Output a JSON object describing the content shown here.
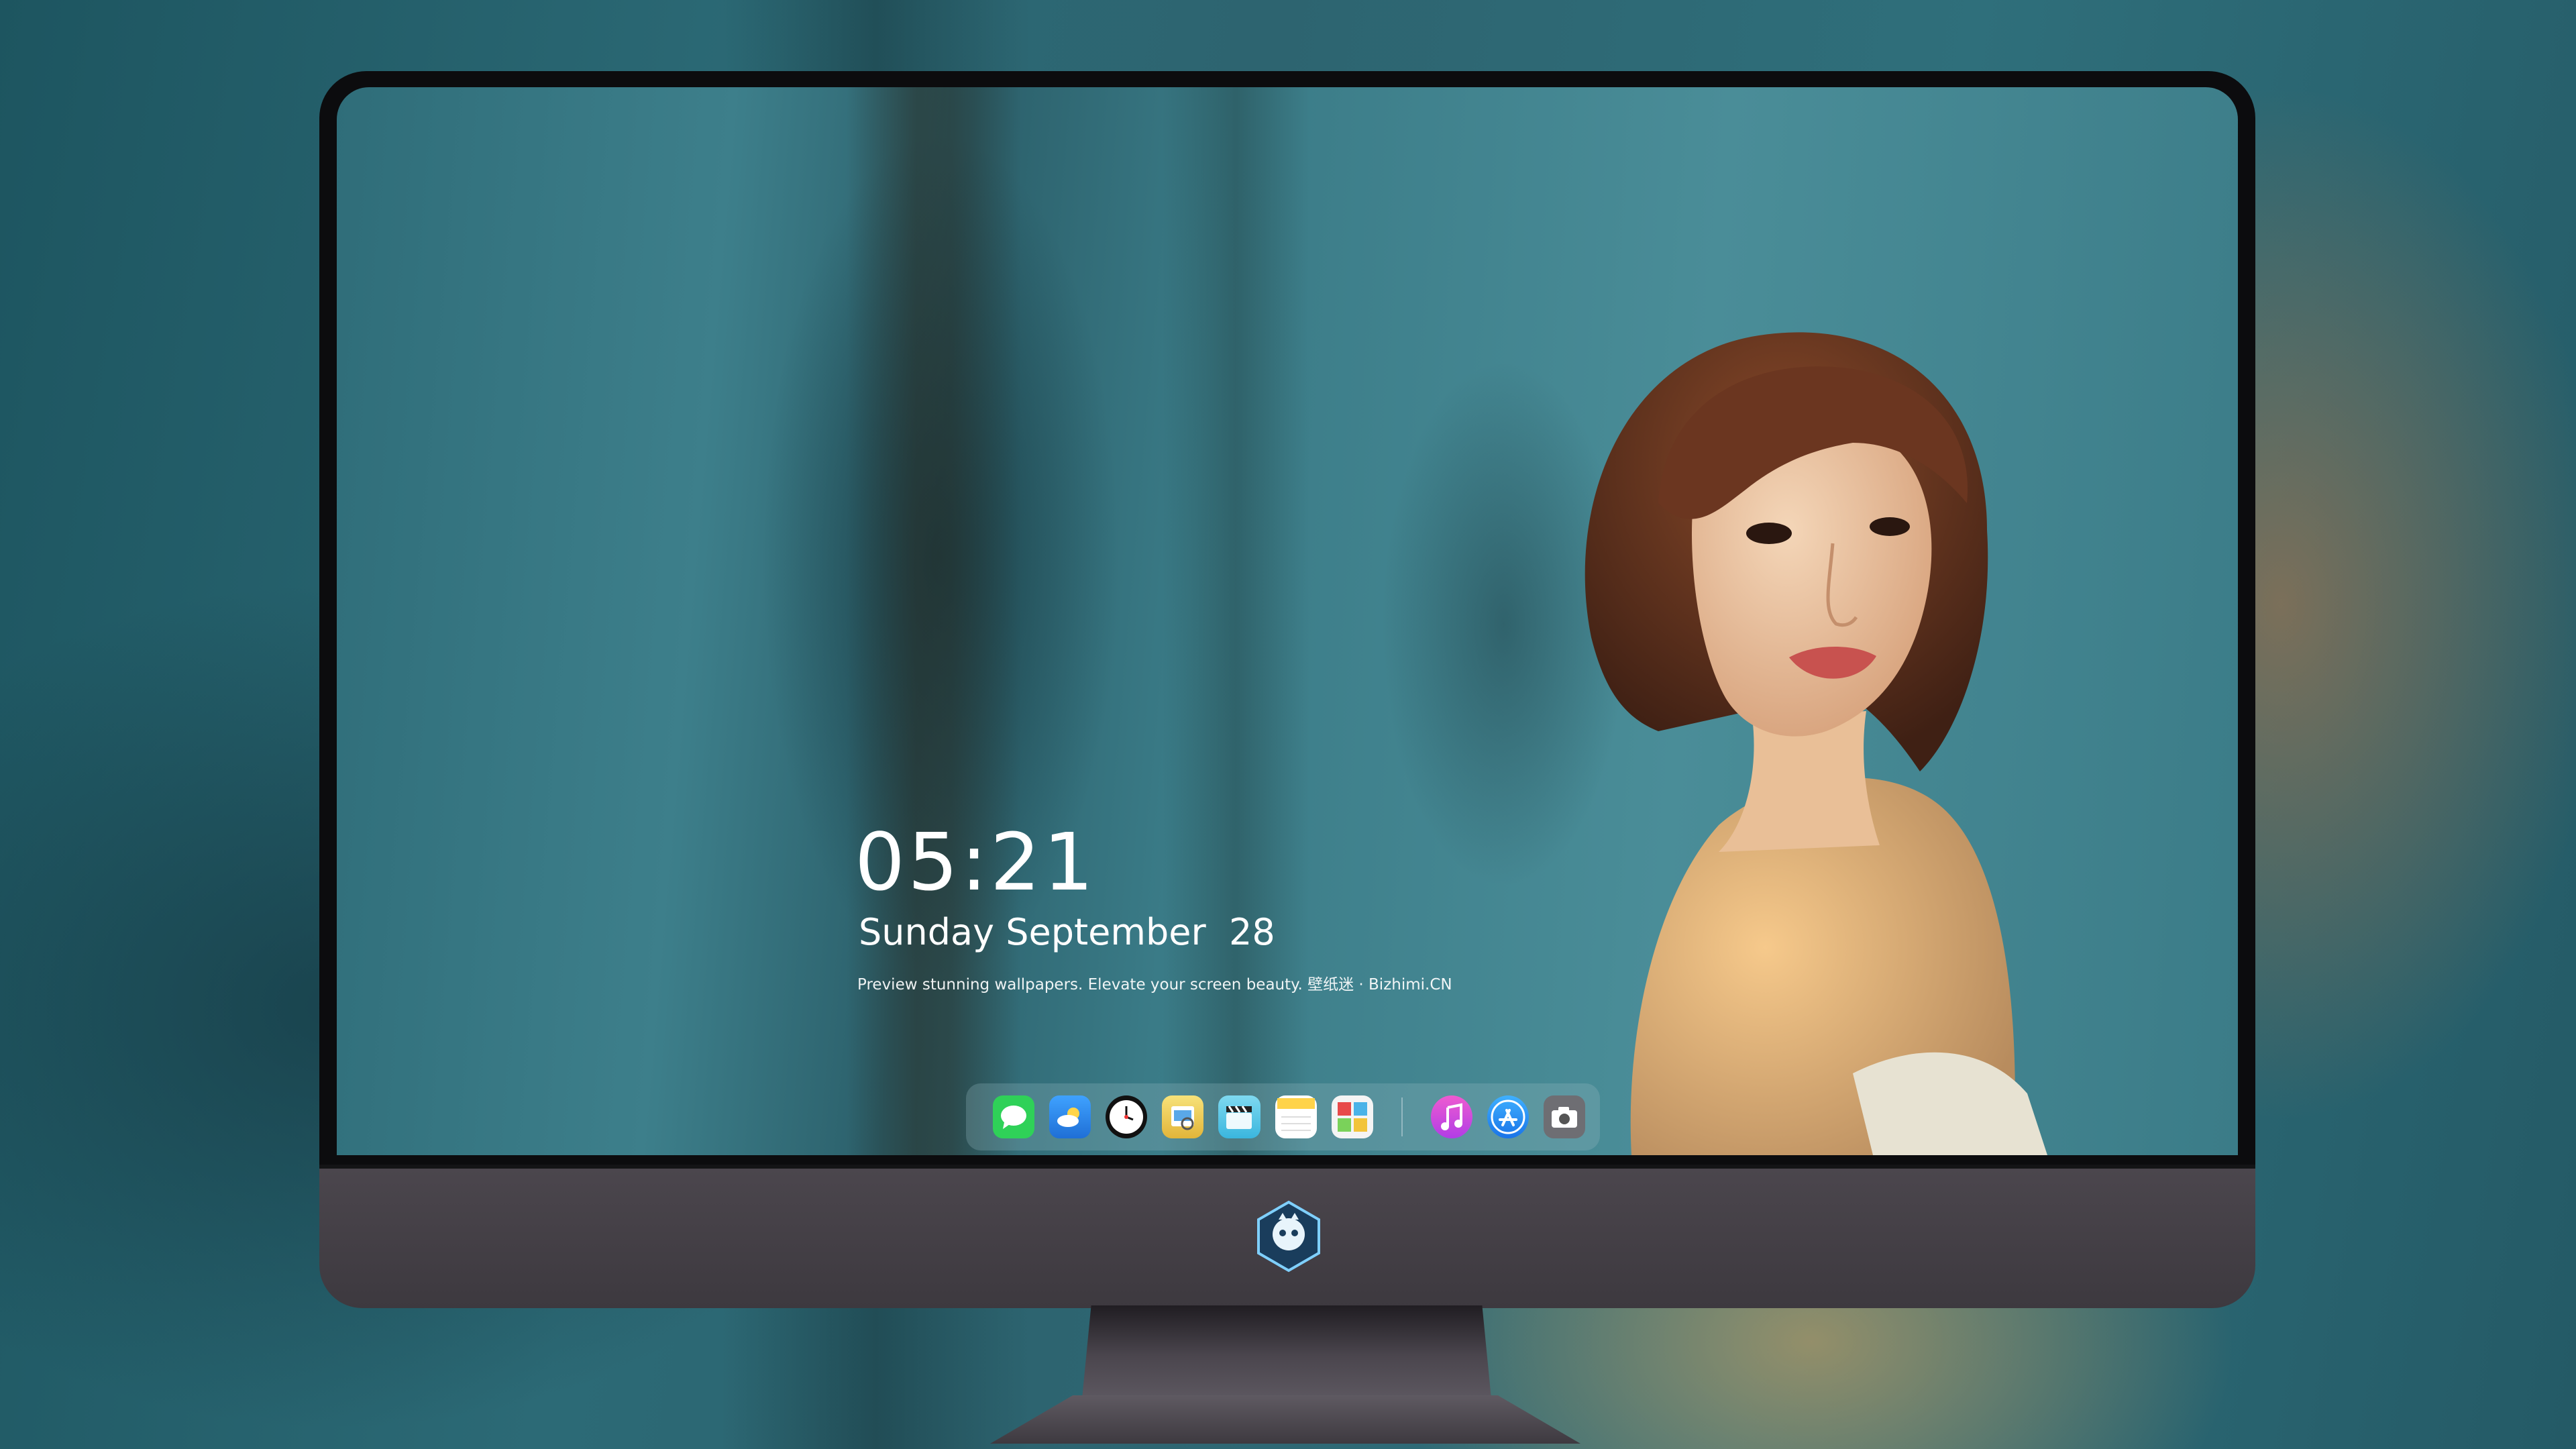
{
  "lockscreen": {
    "time": "05:21",
    "date": "Sunday September  28",
    "tagline": "Preview stunning wallpapers. Elevate your screen beauty. 壁纸迷 · Bizhimi.CN"
  },
  "dock": {
    "apps": [
      {
        "name": "Messages",
        "icon": "messages-icon",
        "color": "#2fd158"
      },
      {
        "name": "Weather",
        "icon": "weather-icon",
        "color": "#2a8cf0"
      },
      {
        "name": "Clock",
        "icon": "clock-icon",
        "color": "#111111"
      },
      {
        "name": "Preview",
        "icon": "preview-icon",
        "color": "#f2d14a"
      },
      {
        "name": "Video",
        "icon": "clapperboard-icon",
        "color": "#4fc7e8"
      },
      {
        "name": "Notes",
        "icon": "notes-icon",
        "color": "#ffd74a"
      },
      {
        "name": "Photo Booth",
        "icon": "photo-booth-icon",
        "color": "#3aa1e0"
      },
      {
        "name": "Music",
        "icon": "music-icon",
        "color": "#d34ce6"
      },
      {
        "name": "App Store",
        "icon": "app-store-icon",
        "color": "#1d8ff2"
      },
      {
        "name": "Camera",
        "icon": "camera-icon",
        "color": "#6e6e73"
      }
    ]
  },
  "colors": {
    "background": "#2c6a76",
    "monitor_chin": "#4b464d",
    "bezel": "#0c0c0e"
  }
}
